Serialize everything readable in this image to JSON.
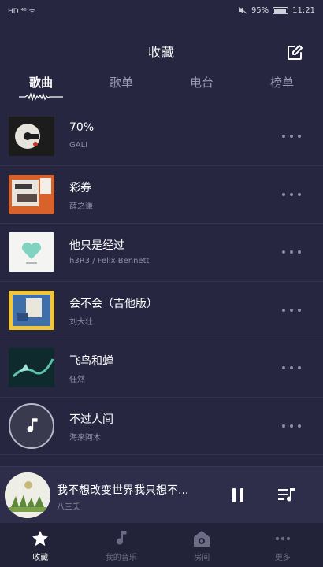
{
  "status_bar": {
    "left_icons": "HD ⁴⁶ ᯤ",
    "battery": "95%",
    "time": "11:21"
  },
  "header": {
    "title": "收藏",
    "edit_icon": "edit-icon"
  },
  "tabs": [
    {
      "label": "歌曲",
      "active": true
    },
    {
      "label": "歌单",
      "active": false
    },
    {
      "label": "电台",
      "active": false
    },
    {
      "label": "榜单",
      "active": false
    }
  ],
  "songs": [
    {
      "title": "70%",
      "artist": "GALI"
    },
    {
      "title": "彩券",
      "artist": "薛之谦"
    },
    {
      "title": "他只是经过",
      "artist": "h3R3 / Felix Bennett"
    },
    {
      "title": "会不会（吉他版）",
      "artist": "刘大壮"
    },
    {
      "title": "飞鸟和蝉",
      "artist": "任然"
    },
    {
      "title": "不过人间",
      "artist": "海来阿木"
    }
  ],
  "player": {
    "title": "我不想改变世界我只想不...",
    "artist": "八三夭"
  },
  "bottom_nav": [
    {
      "label": "收藏",
      "icon": "star-icon",
      "active": true
    },
    {
      "label": "我的音乐",
      "icon": "music-note-icon",
      "active": false
    },
    {
      "label": "房间",
      "icon": "room-icon",
      "active": false
    },
    {
      "label": "更多",
      "icon": "more-icon",
      "active": false
    }
  ],
  "colors": {
    "background": "#262640",
    "player_bar": "#2e2e4a",
    "nav_bar": "#222238",
    "muted_text": "#8e8ea6"
  }
}
